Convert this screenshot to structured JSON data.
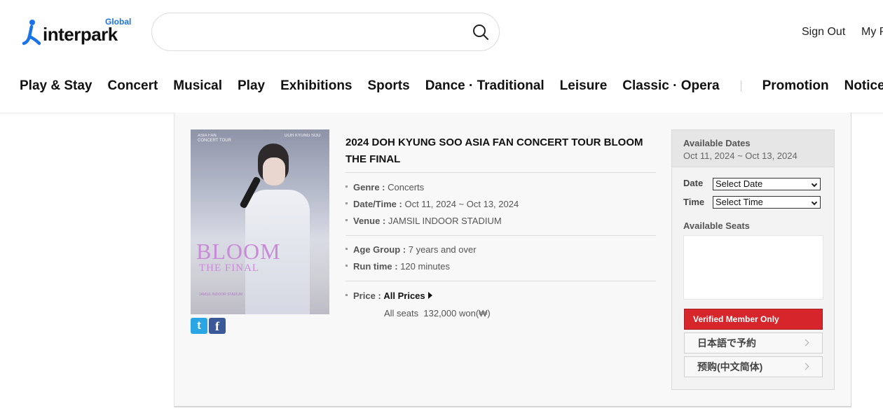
{
  "header": {
    "logo": {
      "brand": "interpark",
      "region": "Global"
    },
    "search": {
      "value": "",
      "placeholder": ""
    },
    "links": {
      "sign_out": "Sign Out",
      "my_page": "My P"
    }
  },
  "nav": {
    "items": [
      "Play & Stay",
      "Concert",
      "Musical",
      "Play",
      "Exhibitions",
      "Sports",
      "Dance · Traditional",
      "Leisure",
      "Classic · Opera"
    ],
    "extra": [
      "Promotion",
      "Notice"
    ]
  },
  "event": {
    "title": "2024 DOH KYUNG SOO ASIA FAN CONCERT TOUR BLOOM THE FINAL",
    "poster": {
      "top_left": "ASIA FAN\nCONCERT TOUR",
      "top_right": "DOH KYUNG SOO",
      "bloom": "BLOOM",
      "final": "THE FINAL",
      "venue": "JAMSIL INDOOR STADIUM"
    },
    "genre": {
      "label": "Genre :",
      "value": "Concerts"
    },
    "datetime": {
      "label": "Date/Time :",
      "value": "Oct 11, 2024 ~ Oct 13, 2024"
    },
    "venue": {
      "label": "Venue :",
      "value": "JAMSIL INDOOR STADIUM"
    },
    "age_group": {
      "label": "Age Group :",
      "value": "7 years and over"
    },
    "run_time": {
      "label": "Run time :",
      "value": "120 minutes"
    },
    "price": {
      "label": "Price :",
      "link": "All Prices",
      "seat_name": "All seats",
      "seat_price": "132,000 won(₩)"
    }
  },
  "share": {
    "twitter": "t",
    "facebook": "f"
  },
  "booking": {
    "available_dates_label": "Available Dates",
    "available_dates": "Oct 11, 2024 ~ Oct 13, 2024",
    "date_label": "Date",
    "date_select": "Select Date",
    "time_label": "Time",
    "time_select": "Select Time",
    "available_seats_label": "Available Seats",
    "verified_button": "Verified Member Only",
    "japanese_button": "日本語で予約",
    "chinese_button": "预购(中文简体)"
  },
  "colors": {
    "accent_red": "#d7262b",
    "brand_blue": "#1a73e8"
  }
}
